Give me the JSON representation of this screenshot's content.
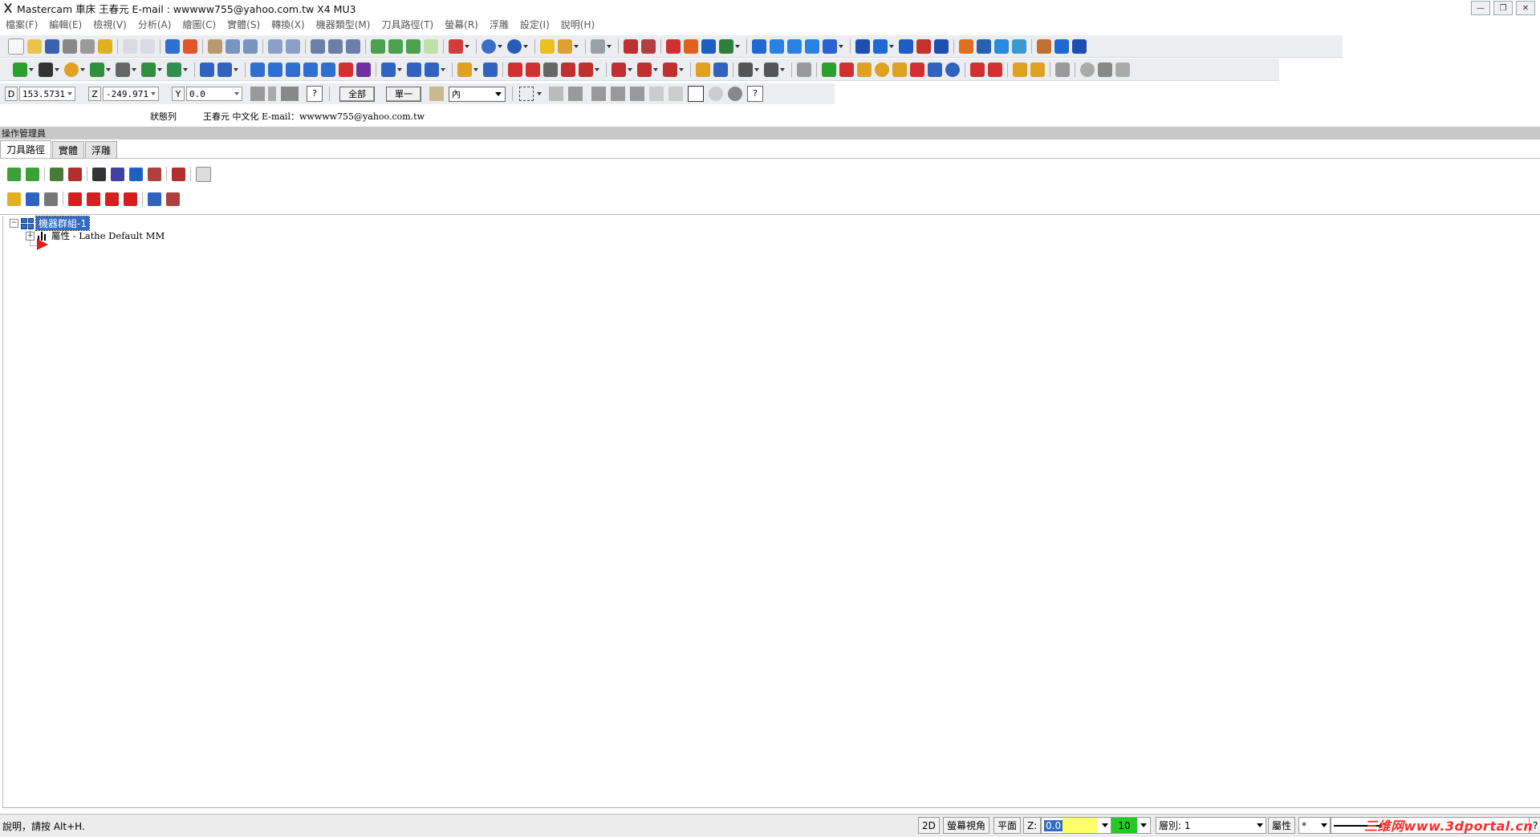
{
  "window": {
    "title": "Mastercam 車床 王春元 E-mail : wwwww755@yahoo.com.tw X4 MU3"
  },
  "menu": [
    "檔案(F)",
    "編輯(E)",
    "檢視(V)",
    "分析(A)",
    "繪圖(C)",
    "實體(S)",
    "轉換(X)",
    "機器類型(M)",
    "刀具路徑(T)",
    "螢幕(R)",
    "浮雕",
    "設定(I)",
    "說明(H)"
  ],
  "coordbar": {
    "x_label": "D",
    "x_value": "153.5731",
    "z_label": "Z",
    "z_value": "-249.971",
    "y_label": "Y",
    "y_value": "0.0",
    "all_button": "全部",
    "single_button": "單一",
    "select_value": "內"
  },
  "statusline": {
    "label": "狀態列",
    "text": "王春元 中文化 E-mail：wwwww755@yahoo.com.tw"
  },
  "opmgr": {
    "header": "操作管理員",
    "tabs": [
      "刀具路徑",
      "實體",
      "浮雕"
    ],
    "tree_root": "機器群組-1",
    "tree_child": "屬性 - Lathe Default MM"
  },
  "bottombar": {
    "hint": "說明，請按 Alt+H.",
    "mode_2d": "2D",
    "screen_view": "螢幕視角",
    "plane": "平面",
    "z_label": "Z:",
    "z_value": "0.0",
    "color_value": "10",
    "level": "層別: 1",
    "attributes": "屬性",
    "watermark": "三维网www.3dportal.cn"
  },
  "colors": {
    "toolbar_bg": "#ecedf0",
    "selection_blue": "#316ac5",
    "z_yellow": "#ffff66",
    "color_green": "#22cc22",
    "watermark_red": "#ff2a2a"
  }
}
